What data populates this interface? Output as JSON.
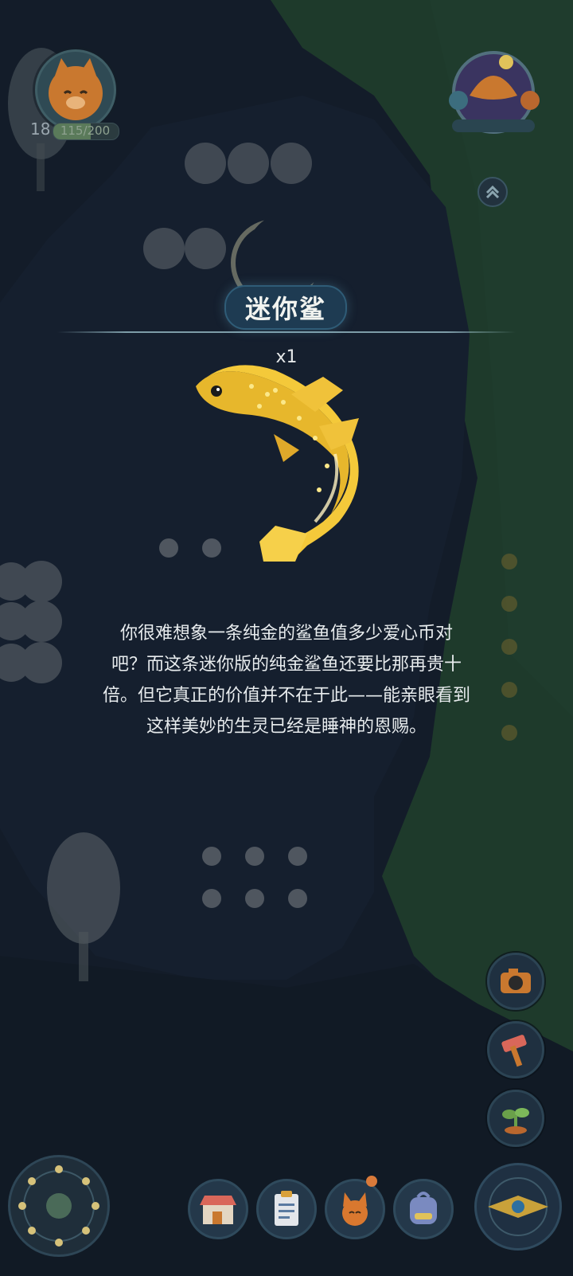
{
  "player": {
    "level": "18",
    "xp_text": "115/200",
    "xp_progress": 0.575
  },
  "reward": {
    "item_name": "迷你鲨",
    "quantity": "x1",
    "description": "你很难想象一条纯金的鲨鱼值多少爱心币对\n吧？而这条迷你版的纯金鲨鱼还要比那再贵十\n倍。但它真正的价值并不在于此——能亲眼看到\n这样美妙的生灵已经是睡神的恩赐。",
    "fish_color": "#f4c93a"
  },
  "icons": {
    "avatar": "cat-avatar-icon",
    "top_right": "fan-weather-icon",
    "collapse": "chevron-up-icon",
    "camera": "camera-icon",
    "build": "hammer-icon",
    "plant": "sprout-icon",
    "shop": "shop-icon",
    "tasks": "clipboard-icon",
    "pets": "fox-icon",
    "bag": "backpack-icon",
    "dial": "moon-dial-icon",
    "compass": "compass-icon"
  },
  "colors": {
    "water": "#1c2a3a",
    "grass": "#2e5a3a",
    "accent_gold": "#f4c93a",
    "title_bg": "#1e3b52"
  }
}
